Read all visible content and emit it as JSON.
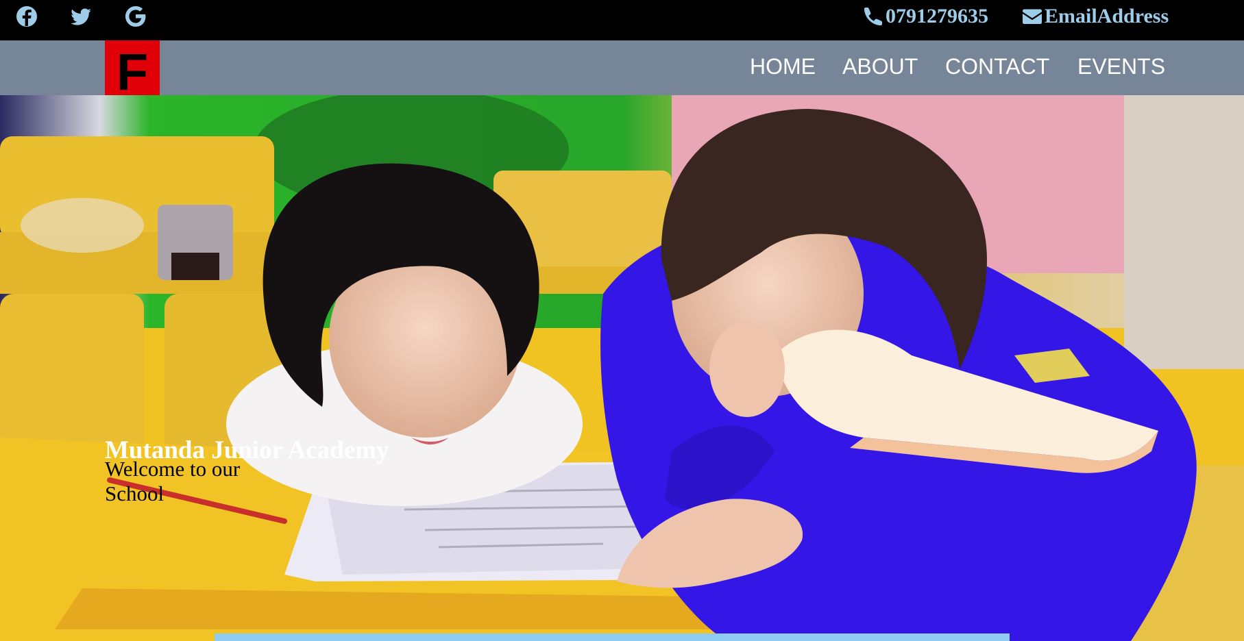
{
  "topbar": {
    "social": [
      {
        "icon": "facebook-icon",
        "label": "Facebook"
      },
      {
        "icon": "twitter-icon",
        "label": "Twitter"
      },
      {
        "icon": "google-icon",
        "label": "Google"
      }
    ],
    "phone": "0791279635",
    "email": "EmailAddress",
    "text_color": "#9ecdea"
  },
  "navbar": {
    "logo_letter": "F",
    "logo_color": "#e10008",
    "background": "#778599",
    "links": [
      "HOME",
      "ABOUT",
      "CONTACT",
      "EVENTS"
    ]
  },
  "hero": {
    "title": "Mutanda Junior Academy",
    "subtitle": "Welcome to our School"
  }
}
